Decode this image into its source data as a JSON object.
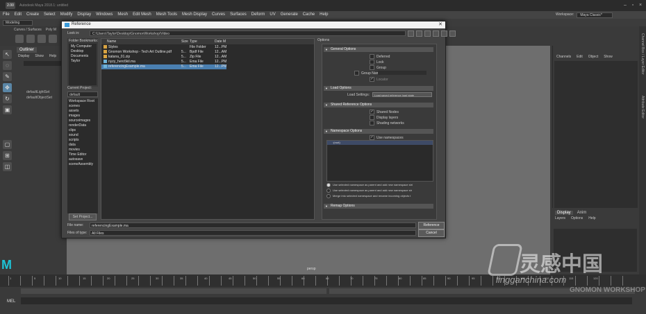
{
  "app": {
    "title": "Autodesk Maya 2018.1: untitled",
    "logo": "2.00"
  },
  "menubar": [
    "File",
    "Edit",
    "Create",
    "Select",
    "Modify",
    "Display",
    "Windows",
    "Mesh",
    "Edit Mesh",
    "Mesh Tools",
    "Mesh Display",
    "Curves",
    "Surfaces",
    "Deform",
    "UV",
    "Generate",
    "Cache",
    "Help"
  ],
  "workspace": {
    "label": "Workspace:",
    "value": "Maya Classic*"
  },
  "status": {
    "mode": "Modeling"
  },
  "shelf": {
    "tabs": [
      "Curves / Surfaces",
      "Poly M"
    ],
    "buttons": [
      "polyPlane",
      "polySphere",
      "polyCube",
      "polyTool"
    ]
  },
  "outliner": {
    "title": "Outliner",
    "menu": [
      "Display",
      "Show",
      "Help"
    ],
    "items": [
      "defaultLightSet",
      "defaultObjectSet"
    ]
  },
  "dialog": {
    "title": "Reference",
    "look_in_label": "Look in:",
    "path": "C:\\Users\\Taylor\\Desktop\\GnomonWorkshop\\Video",
    "bookmarks_label": "Folder Bookmarks:",
    "bookmarks": [
      "My Computer",
      "Desktop",
      "Documents",
      "Taylor"
    ],
    "current_project_label": "Current Project:",
    "current_project": "default",
    "project_dirs": [
      "Workspace Root",
      "scenes",
      "assets",
      "images",
      "sourceimages",
      "renderData",
      "clips",
      "sound",
      "scripts",
      "data",
      "movies",
      "Time Editor",
      "autosave",
      "sceneAssembly"
    ],
    "set_project": "Set Project...",
    "columns": [
      "Name",
      "Size",
      "Type",
      "Date M"
    ],
    "files": [
      {
        "name": "Styles",
        "size": "",
        "type": "File Folder",
        "date": "12...PM"
      },
      {
        "name": "Gnomon Workshop - Tech Art Outline.pdf",
        "size": "5...",
        "type": "Bpdf File",
        "date": "12...AM"
      },
      {
        "name": "katana_01.zip",
        "size": "5...",
        "type": "Zip File",
        "date": "12...AM"
      },
      {
        "name": "nyzy_hero5kil.ma",
        "size": "5...",
        "type": "Ema File",
        "date": "12...PM"
      },
      {
        "name": "referencingExample.ma",
        "size": "5...",
        "type": "Ema File",
        "date": "12...PM"
      }
    ],
    "selected_index": 4,
    "options_label": "Options",
    "general": {
      "title": "General Options",
      "items": [
        "Deferred",
        "Lock",
        "Group"
      ],
      "group_name_label": "Group Name",
      "locator": "Locator"
    },
    "load": {
      "title": "Load Options",
      "label": "Load Settings:",
      "value": "Load saved reference load state"
    },
    "shared": {
      "title": "Shared Reference Options",
      "items": [
        "Shared Nodes",
        "Display layers",
        "Shading networks"
      ]
    },
    "namespace": {
      "title": "Namespace Options",
      "use_namespaces": "Use namespaces",
      "root": ":(root)",
      "choices": [
        "Use selected namespace as parent and add new namespace stri",
        "Use selected namespace as parent and add new namespace str",
        "Merge into selected namespace and rename incoming objects t"
      ]
    },
    "more": "Remap Options",
    "file_name_label": "File name:",
    "file_name": "referencingExample.ma",
    "file_type_label": "Files of type:",
    "file_type": "All Files",
    "reference_btn": "Reference",
    "cancel_btn": "Cancel"
  },
  "viewport": {
    "camera": "persp"
  },
  "channelbox": {
    "menu": [
      "Channels",
      "Edit",
      "Object",
      "Show"
    ]
  },
  "layers": {
    "tabs": [
      "Display",
      "Anim"
    ],
    "menu": [
      "Layers",
      "Options",
      "Help"
    ]
  },
  "side_tabs": [
    "Channel Box / Layer Editor",
    "Attribute Editor"
  ],
  "timeline": {
    "ticks": [
      "1",
      "5",
      "10",
      "15",
      "20",
      "25",
      "30",
      "35",
      "40",
      "45",
      "50",
      "55",
      "60",
      "65",
      "70",
      "75",
      "80",
      "85",
      "90",
      "95",
      "100",
      "105",
      "110",
      "115",
      "120"
    ]
  },
  "mel": {
    "label": "MEL"
  },
  "watermark": {
    "cn": "灵感中国",
    "url": "lingganchina.com",
    "gnomon": "GNOMON WORKSHOP"
  }
}
